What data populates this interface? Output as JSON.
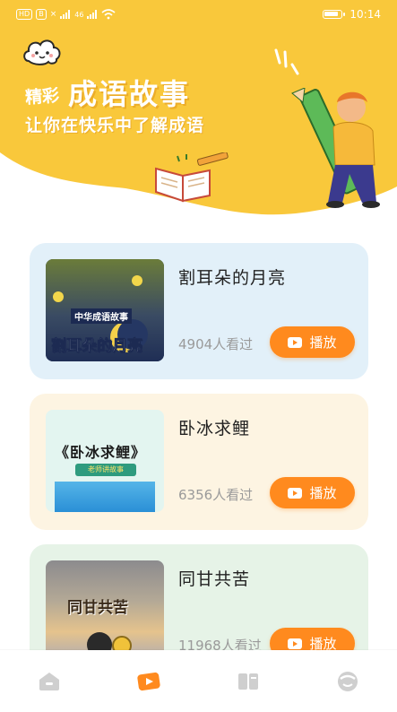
{
  "status_bar": {
    "left_tags": [
      "HD",
      "B"
    ],
    "signal_labels": [
      "×",
      "46"
    ],
    "time": "10:14"
  },
  "header": {
    "title_small": "精彩",
    "title_big": "成语故事",
    "subtitle": "让你在快乐中了解成语",
    "background_color": "#F9C83B"
  },
  "cards": [
    {
      "title": "割耳朵的月亮",
      "views": "4904人看过",
      "play_label": "播放",
      "thumb_top_text": "中华成语故事",
      "thumb_main_text": "割耳朵的月亮"
    },
    {
      "title": "卧冰求鲤",
      "views": "6356人看过",
      "play_label": "播放",
      "thumb_main_text": "《卧冰求鲤》",
      "thumb_tag_text": "老师讲故事"
    },
    {
      "title": "同甘共苦",
      "views": "11968人看过",
      "play_label": "播放",
      "thumb_main_text": "同甘共苦"
    }
  ],
  "tabbar": {
    "items": [
      "home-icon",
      "video-icon",
      "book-icon",
      "profile-icon"
    ],
    "active_index": 1,
    "active_color": "#FF8A1E",
    "inactive_color": "#CFCFCF"
  },
  "colors": {
    "accent": "#FF8A1E",
    "card_1_bg": "#E2F0F9",
    "card_2_bg": "#FDF4E2",
    "card_3_bg": "#E6F3E7"
  }
}
